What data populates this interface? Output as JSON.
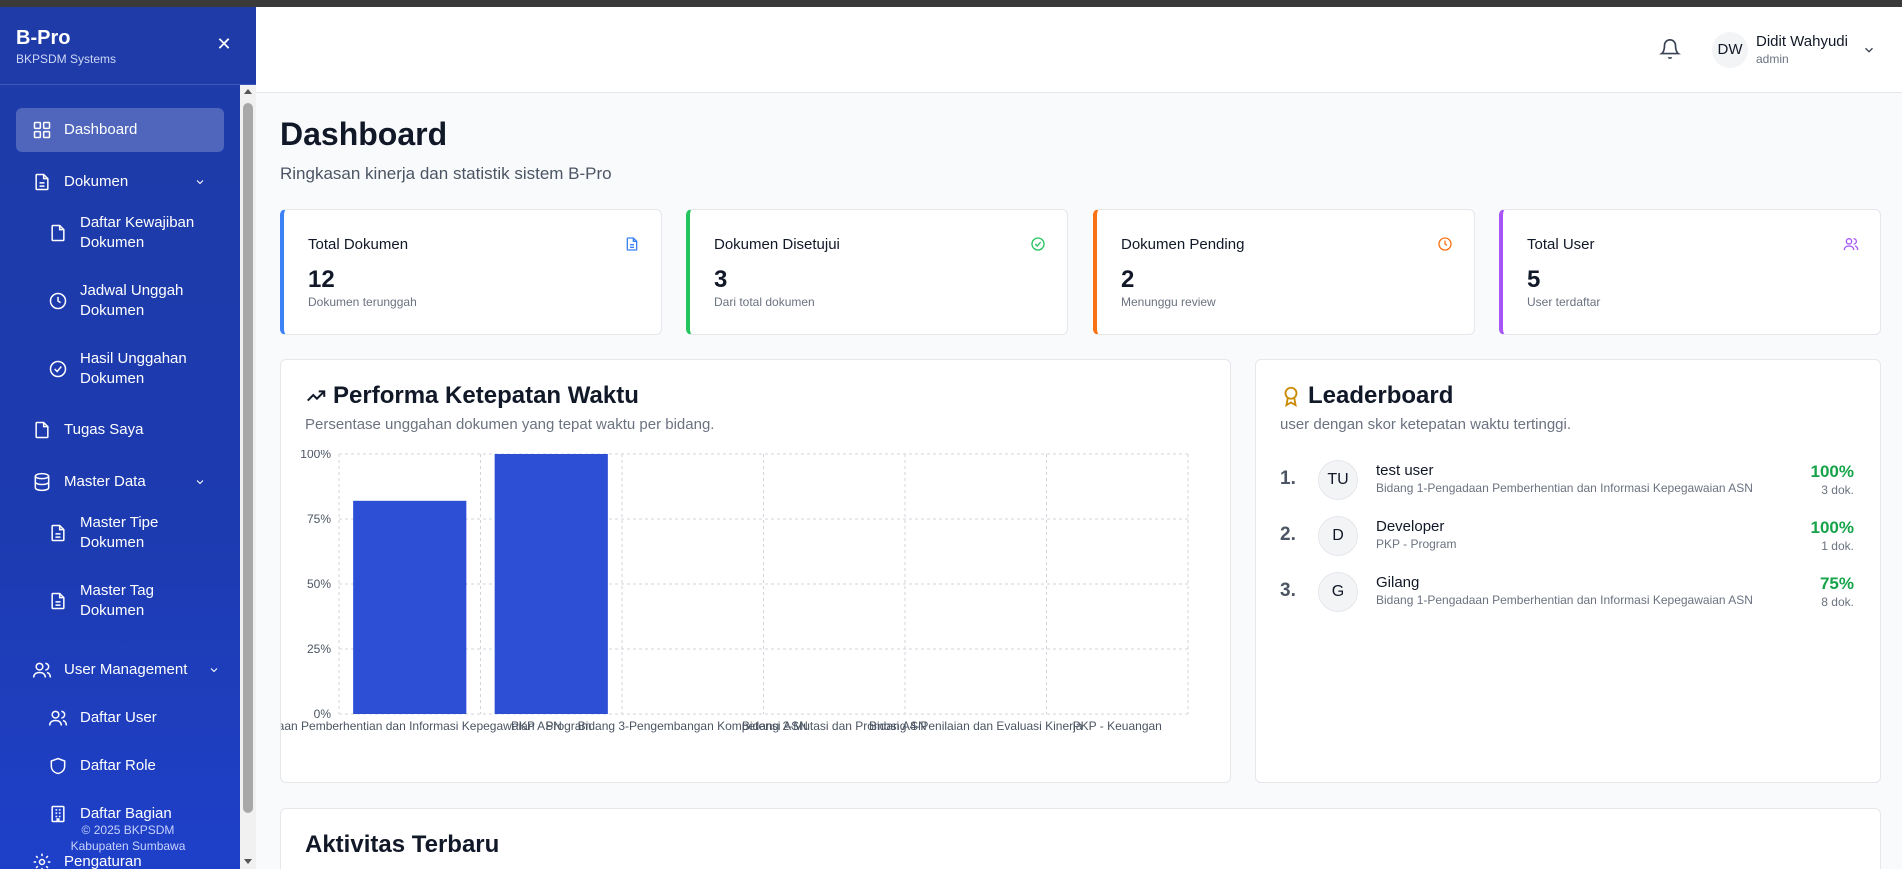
{
  "sidebar": {
    "brand": "B-Pro",
    "brand_sub": "BKPSDM Systems",
    "items": [
      {
        "label": "Dashboard"
      },
      {
        "label": "Dokumen"
      },
      {
        "label": "Daftar Kewajiban Dokumen"
      },
      {
        "label": "Jadwal Unggah Dokumen"
      },
      {
        "label": "Hasil Unggahan Dokumen"
      },
      {
        "label": "Tugas Saya"
      },
      {
        "label": "Master Data"
      },
      {
        "label": "Master Tipe Dokumen"
      },
      {
        "label": "Master Tag Dokumen"
      },
      {
        "label": "User Management"
      },
      {
        "label": "Daftar User"
      },
      {
        "label": "Daftar Role"
      },
      {
        "label": "Daftar Bagian"
      },
      {
        "label": "Pengaturan"
      }
    ],
    "footer_line1": "© 2025 BKPSDM",
    "footer_line2": "Kabupaten Sumbawa"
  },
  "header": {
    "avatar_initials": "DW",
    "user_name": "Didit Wahyudi",
    "user_role": "admin"
  },
  "page": {
    "title": "Dashboard",
    "subtitle": "Ringkasan kinerja dan statistik sistem B-Pro"
  },
  "stats": [
    {
      "title": "Total Dokumen",
      "value": "12",
      "desc": "Dokumen terunggah",
      "color": "#3b82f6"
    },
    {
      "title": "Dokumen Disetujui",
      "value": "3",
      "desc": "Dari total dokumen",
      "color": "#22c55e"
    },
    {
      "title": "Dokumen Pending",
      "value": "2",
      "desc": "Menunggu review",
      "color": "#f97316"
    },
    {
      "title": "Total User",
      "value": "5",
      "desc": "User terdaftar",
      "color": "#a855f7"
    }
  ],
  "performance": {
    "title": "Performa Ketepatan Waktu",
    "subtitle": "Persentase unggahan dokumen yang tepat waktu per bidang."
  },
  "chart_data": {
    "type": "bar",
    "categories": [
      "gadaan Pemberhentian dan Informasi Kepegawaian ASN",
      "PKP - Program",
      "Bidang 3-Pengembangan Kompetensi ASN",
      "Bidang 2-Mutasi dan Promosi ASN",
      "Bidang 4-Penilaian dan Evaluasi Kinerja",
      "PKP - Keuangan"
    ],
    "values": [
      82,
      100,
      0,
      0,
      0,
      0
    ],
    "yticks": [
      "0%",
      "25%",
      "50%",
      "75%",
      "100%"
    ],
    "ylim": [
      0,
      100
    ],
    "grid": true,
    "bar_color": "#2c4fd6"
  },
  "leaderboard": {
    "title": "Leaderboard",
    "subtitle": "user dengan skor ketepatan waktu tertinggi.",
    "rows": [
      {
        "rank": "1.",
        "initials": "TU",
        "name": "test user",
        "dept": "Bidang 1-Pengadaan Pemberhentian dan Informasi Kepegawaian ASN",
        "score": "100%",
        "count": "3 dok."
      },
      {
        "rank": "2.",
        "initials": "D",
        "name": "Developer",
        "dept": "PKP - Program",
        "score": "100%",
        "count": "1 dok."
      },
      {
        "rank": "3.",
        "initials": "G",
        "name": "Gilang",
        "dept": "Bidang 1-Pengadaan Pemberhentian dan Informasi Kepegawaian ASN",
        "score": "75%",
        "count": "8 dok."
      }
    ]
  },
  "activity": {
    "title": "Aktivitas Terbaru"
  }
}
